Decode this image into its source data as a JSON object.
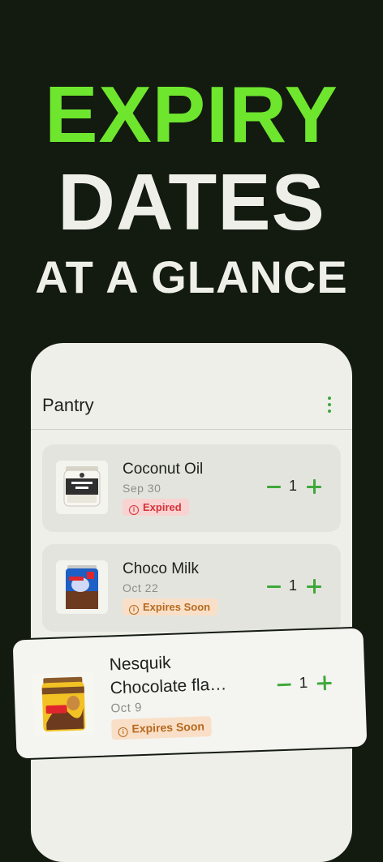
{
  "headline": {
    "line1": "EXPIRY",
    "line2": "DATES",
    "line3": "AT A GLANCE"
  },
  "app": {
    "title": "Pantry"
  },
  "items": [
    {
      "name": "Coconut Oil",
      "date": "Sep 30",
      "status": "Expired",
      "quantity": "1"
    },
    {
      "name": "Choco Milk",
      "date": "Oct 22",
      "status": "Expires Soon",
      "quantity": "1"
    },
    {
      "name_line1": "Nesquik",
      "name_line2": "Chocolate fla…",
      "date": "Oct 9",
      "status": "Expires Soon",
      "quantity": "1"
    }
  ],
  "status_icon": "i",
  "colors": {
    "background": "#131a10",
    "accent_green": "#6ee62e",
    "action_green": "#3fa83a",
    "expired": "#d5333a",
    "expires_soon": "#b66a1e"
  }
}
